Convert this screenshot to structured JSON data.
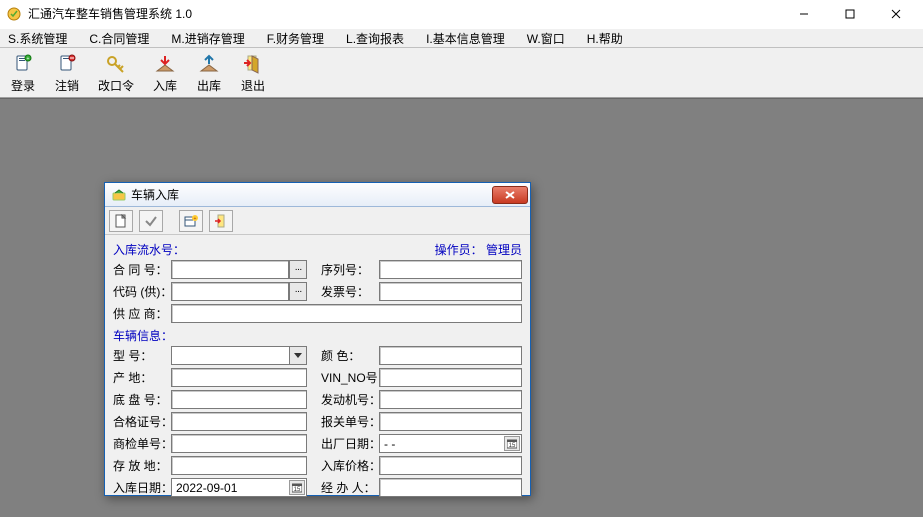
{
  "window": {
    "title": "汇通汽车整车销售管理系统 1.0"
  },
  "menus": {
    "system": "S.系统管理",
    "contract": "C.合同管理",
    "stock": "M.进销存管理",
    "finance": "F.财务管理",
    "query": "L.查询报表",
    "baseinfo": "I.基本信息管理",
    "window_m": "W.窗口",
    "help": "H.帮助"
  },
  "toolbar": {
    "login": "登录",
    "logout": "注销",
    "password": "改口令",
    "in_stock": "入库",
    "out_stock": "出库",
    "exit": "退出"
  },
  "dialog": {
    "title": "车辆入库",
    "section_inbound": "入库流水号：",
    "section_vehicle": "车辆信息：",
    "operator_label": "操作员：",
    "operator_value": "管理员",
    "labels": {
      "contract_no": "合 同 号：",
      "supplier_code": "代码 (供)：",
      "supplier": "供 应 商：",
      "serial_no": "序列号：",
      "invoice_no": "发票号：",
      "model": "型    号：",
      "origin": "产    地：",
      "chassis_no": "底 盘 号：",
      "cert_no": "合格证号：",
      "inspect_no": "商检单号：",
      "storage": "存 放 地：",
      "in_date": "入库日期：",
      "color": "颜    色：",
      "vin_no": "VIN_NO号：",
      "engine_no": "发动机号：",
      "customs_no": "报关单号：",
      "out_date": "出厂日期：",
      "in_price": "入库价格：",
      "handler": "经 办 人："
    },
    "values": {
      "in_date": "2022-09-01",
      "out_date": "  -  -"
    },
    "browse": "···"
  }
}
